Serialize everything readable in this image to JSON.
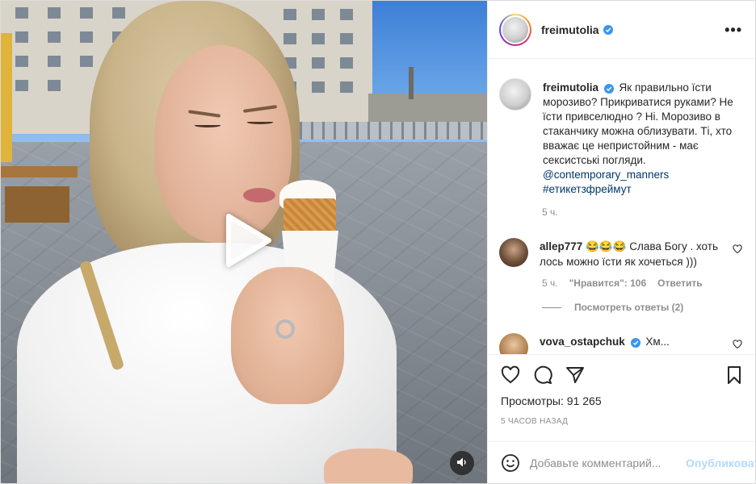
{
  "post": {
    "author": "freimutolia",
    "verified": true,
    "caption": "Як правильно їсти морозиво? Прикриватися руками? Не їсти привселюдно ? Ні. Морозиво в стаканчику можна облизувати. Ті, хто вважає це непристойним - має сексистські погляди.",
    "mention": "@contemporary_manners",
    "hashtag": "#етикетзфреймут",
    "caption_time": "5 ч.",
    "views_label": "Просмотры:",
    "views_count": "91 265",
    "posted_ago": "5 часов назад"
  },
  "comments": [
    {
      "user": "allep777",
      "text": "😂😂😂 Слава Богу . хоть лось можно їсти як хочеться )))",
      "time": "5 ч.",
      "likes_label": "\"Нравится\": 106",
      "reply_label": "Ответить",
      "view_replies": "Посмотреть ответы (2)"
    },
    {
      "user": "vova_ostapchuk",
      "verified": true,
      "text": "Хм..."
    }
  ],
  "add_comment": {
    "placeholder": "Добавьте комментарий...",
    "publish_label": "Опубликовать"
  },
  "icons": {
    "more": "more-options-icon",
    "play": "play-icon",
    "mute": "speaker-icon",
    "like": "heart-icon",
    "comment": "comment-icon",
    "share": "share-icon",
    "save": "bookmark-icon",
    "emoji": "emoji-icon"
  },
  "colors": {
    "verified_blue": "#3897f0",
    "link": "#00376b",
    "secondary_text": "#8e8e8e",
    "publish_disabled": "#b3dbff"
  }
}
